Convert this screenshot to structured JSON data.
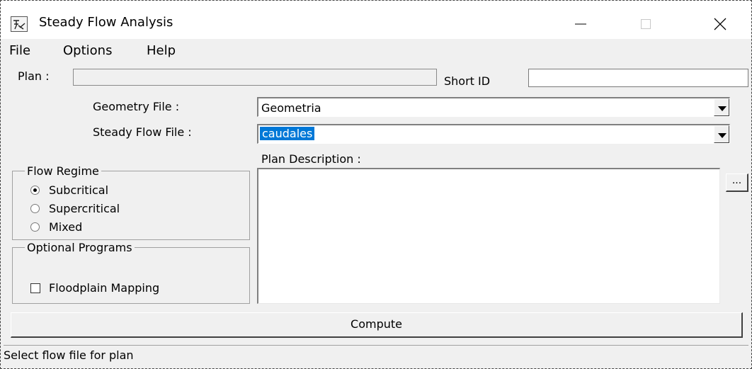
{
  "window": {
    "title": "Steady Flow Analysis",
    "icon": "hec-ras-app-icon",
    "controls": [
      "minimize-icon",
      "maximize-icon",
      "close-icon"
    ]
  },
  "menu": {
    "items": [
      "File",
      "Options",
      "Help"
    ]
  },
  "plan": {
    "label": "Plan :",
    "value": "",
    "short_id_label": "Short ID",
    "short_id_value": ""
  },
  "geometry": {
    "label": "Geometry File :",
    "value": "Geometria"
  },
  "steady_flow": {
    "label": "Steady Flow File :",
    "value": "caudales"
  },
  "plan_description": {
    "label": "Plan Description :",
    "value": "",
    "more_button": "..."
  },
  "flow_regime": {
    "title": "Flow Regime",
    "options": [
      "Subcritical",
      "Supercritical",
      "Mixed"
    ],
    "selected": "Subcritical"
  },
  "optional_programs": {
    "title": "Optional Programs",
    "floodplain_mapping_label": "Floodplain Mapping",
    "floodplain_mapping_checked": false
  },
  "compute_button": "Compute",
  "status_text": "Select flow file for plan",
  "colors": {
    "selection": "#0078d7",
    "background": "#f0f0f0"
  }
}
